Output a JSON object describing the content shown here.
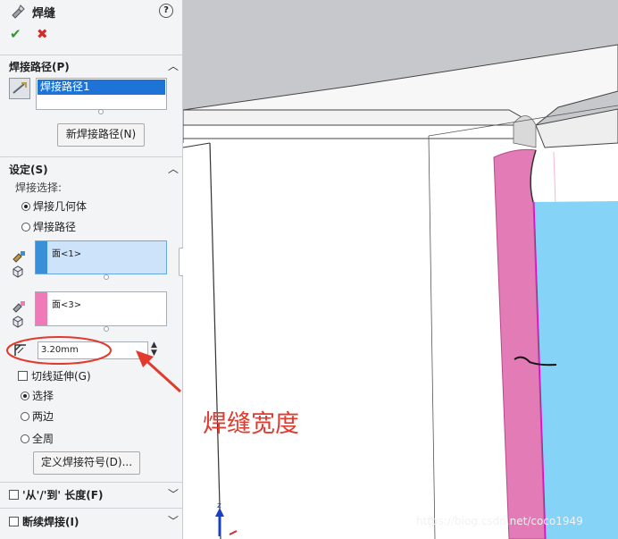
{
  "panel": {
    "title": "焊缝",
    "help_icon": "help-icon",
    "ok_icon": "checkmark-icon",
    "cancel_icon": "close-icon",
    "weld_path_section": {
      "title": "焊接路径(P)",
      "items": [
        "焊接路径1"
      ],
      "new_button": "新焊接路径(N)"
    },
    "settings_section": {
      "title": "设定(S)",
      "weld_select_label": "焊接选择:",
      "options": [
        "焊接几何体",
        "焊接路径"
      ],
      "selected_option": "焊接几何体",
      "face1": "面<1>",
      "face2": "面<3>",
      "weld_size": "3.20mm",
      "tangent_label": "切线延伸(G)",
      "apply_options": [
        "选择",
        "两边",
        "全周"
      ],
      "selected_apply": "选择",
      "define_symbol_button": "定义焊接符号(D)..."
    },
    "from_to_section": {
      "title": "'从'/'到' 长度(F)"
    },
    "intermittent_section": {
      "title": "断续焊接(I)"
    }
  },
  "annotation": {
    "text": "焊缝宽度",
    "color": "#e23b2e"
  },
  "watermark": "https://blog.csdn.net/coco1949",
  "colors": {
    "face1_swatch": "#3a8fd9",
    "face2_swatch": "#f07ab8",
    "weld_bead": "#e37bb7",
    "blue_face": "#85d3f7",
    "selection_blue": "#1e74d6"
  }
}
